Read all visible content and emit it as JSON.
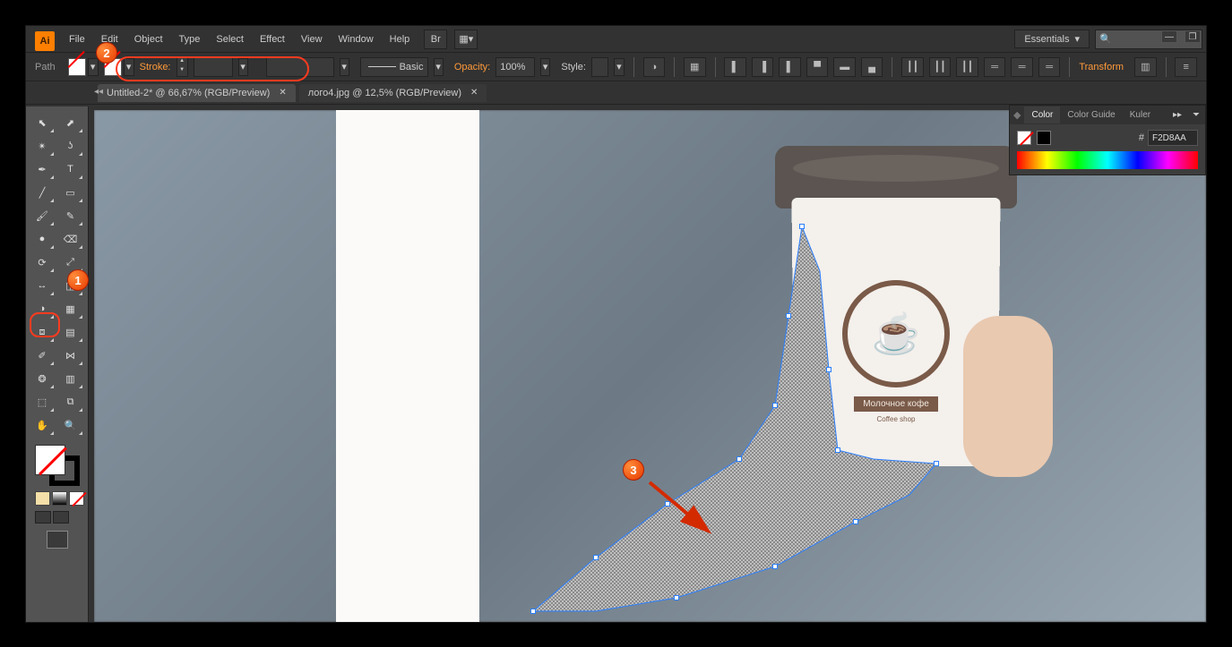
{
  "app": {
    "logo_text": "Ai"
  },
  "window": {
    "min": "—",
    "max": "❐",
    "close": "✕"
  },
  "menubar": {
    "items": [
      "File",
      "Edit",
      "Object",
      "Type",
      "Select",
      "Effect",
      "View",
      "Window",
      "Help"
    ],
    "workspace_label": "Essentials"
  },
  "control_bar": {
    "context_label": "Path",
    "stroke_label": "Stroke:",
    "brush_label": "Basic",
    "opacity_label": "Opacity:",
    "opacity_value": "100%",
    "style_label": "Style:",
    "transform_label": "Transform"
  },
  "tabs": {
    "active": {
      "label": "Untitled-2* @ 66,67% (RGB/Preview)",
      "close": "✕"
    },
    "inactive": {
      "label": "лого4.jpg @ 12,5% (RGB/Preview)",
      "close": "✕"
    }
  },
  "cup_logo": {
    "brand": "Молочное кофе",
    "subtitle": "Coffee shop"
  },
  "callouts": {
    "one": "1",
    "two": "2",
    "three": "3"
  },
  "color_panel": {
    "tabs": [
      "Color",
      "Color Guide",
      "Kuler"
    ],
    "hash": "#",
    "hex": "F2D8AA"
  },
  "tool_names": [
    "selection-tool",
    "direct-selection-tool",
    "magic-wand-tool",
    "lasso-tool",
    "pen-tool",
    "type-tool",
    "line-tool",
    "rectangle-tool",
    "paintbrush-tool",
    "pencil-tool",
    "blob-brush-tool",
    "eraser-tool",
    "rotate-tool",
    "scale-tool",
    "width-tool",
    "free-transform-tool",
    "shape-builder-tool",
    "perspective-grid-tool",
    "mesh-tool",
    "gradient-tool",
    "eyedropper-tool",
    "blend-tool",
    "symbol-sprayer-tool",
    "column-graph-tool",
    "artboard-tool",
    "slice-tool",
    "hand-tool",
    "zoom-tool"
  ],
  "tool_glyphs": [
    "⬉",
    "⬈",
    "✴",
    "ʖ",
    "✒",
    "T",
    "╱",
    "▭",
    "🖌",
    "✎",
    "●",
    "⌫",
    "⟳",
    "⤢",
    "↔",
    "◫",
    "◑",
    "▦",
    "⧈",
    "▤",
    "✐",
    "⋈",
    "❂",
    "▥",
    "⬚",
    "⧉",
    "✋",
    "🔍"
  ]
}
